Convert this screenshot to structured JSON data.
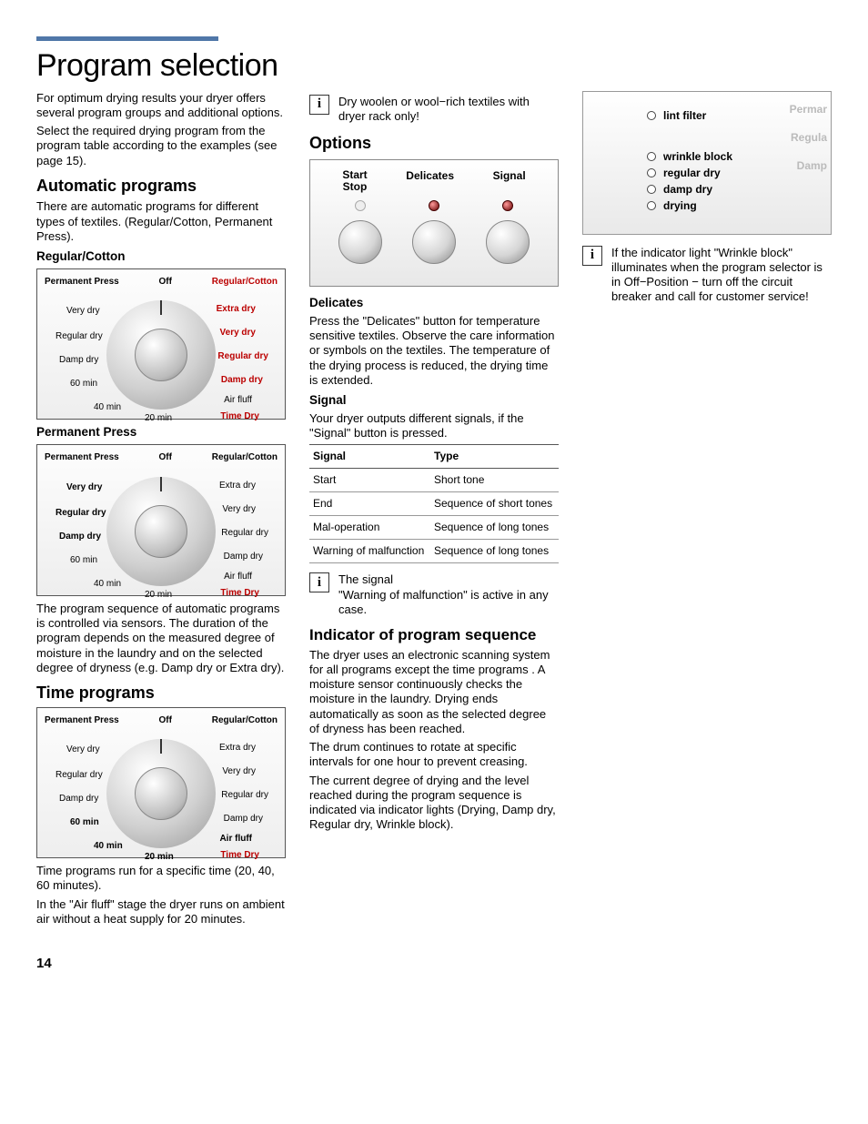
{
  "page": {
    "title": "Program selection",
    "number": "14"
  },
  "col1": {
    "intro1": "For optimum drying results your dryer offers several program groups and additional options.",
    "intro2": "Select the required drying program from the program table according to the examples (see page 15).",
    "auto_h": "Automatic programs",
    "auto_p1": "There are automatic programs for different types of textiles. (Regular/Cotton, Permanent Press).",
    "reg_h": "Regular/Cotton",
    "perm_h": "Permanent Press",
    "auto_p2": "The program sequence of automatic programs is controlled via sensors. The duration of the program depends on the measured degree of moisture in the laundry and on the selected degree of dryness (e.g. Damp dry or Extra dry).",
    "time_h": "Time programs",
    "time_p1": "Time programs run for a specific time (20, 40, 60 minutes).",
    "time_p2": "In the \"Air fluff\" stage the dryer runs on ambient air without a heat supply for 20 minutes."
  },
  "dial": {
    "left_title": "Permanent Press",
    "off": "Off",
    "right_title": "Regular/Cotton",
    "l_very": "Very dry",
    "l_reg": "Regular dry",
    "l_damp": "Damp dry",
    "l_60": "60 min",
    "l_40": "40 min",
    "l_20": "20 min",
    "r_extra": "Extra dry",
    "r_very": "Very dry",
    "r_reg": "Regular dry",
    "r_damp": "Damp dry",
    "r_air": "Air fluff",
    "r_time": "Time Dry"
  },
  "col2": {
    "note_wool": "Dry woolen or wool−rich textiles with dryer rack only!",
    "options_h": "Options",
    "btn_start": "Start",
    "btn_stop": "Stop",
    "btn_delicates": "Delicates",
    "btn_signal": "Signal",
    "del_h": "Delicates",
    "del_p": "Press the \"Delicates\" button for temperature sensitive textiles. Observe the care information or symbols on the textiles. The temperature of the drying process is reduced, the drying time is extended.",
    "sig_h": "Signal",
    "sig_p": "Your dryer outputs different signals, if the \"Signal\" button is pressed.",
    "tbl_h1": "Signal",
    "tbl_h2": "Type",
    "tbl": [
      {
        "s": "Start",
        "t": "Short tone"
      },
      {
        "s": "End",
        "t": "Sequence of short tones"
      },
      {
        "s": "Mal-operation",
        "t": "Sequence of long tones"
      },
      {
        "s": "Warning of malfunction",
        "t": "Sequence of long tones"
      }
    ],
    "note_sig1": "The signal",
    "note_sig2": "\"Warning of malfunction\" is active in any case.",
    "ind_h": "Indicator of program sequence",
    "ind_p1": "The dryer uses an electronic scanning system for all programs except the time programs . A moisture sensor continuously checks the moisture in the laundry. Drying ends automatically as soon as the selected degree of dryness has been reached.",
    "ind_p2": "The drum continues to rotate at specific intervals for one hour to prevent creasing.",
    "ind_p3": "The current degree of drying and the level reached during the program sequence is indicated via indicator lights (Drying, Damp dry, Regular dry, Wrinkle block)."
  },
  "col3": {
    "lint": "lint filter",
    "wrinkle": "wrinkle block",
    "regdry": "regular dry",
    "dampdry": "damp dry",
    "drying": "drying",
    "r1": "Permar",
    "r2": "Regula",
    "r3": "Damp",
    "note": "If the indicator light \"Wrinkle block\" illuminates when the program selector is in Off−Position − turn off the circuit breaker and call for customer service!"
  }
}
